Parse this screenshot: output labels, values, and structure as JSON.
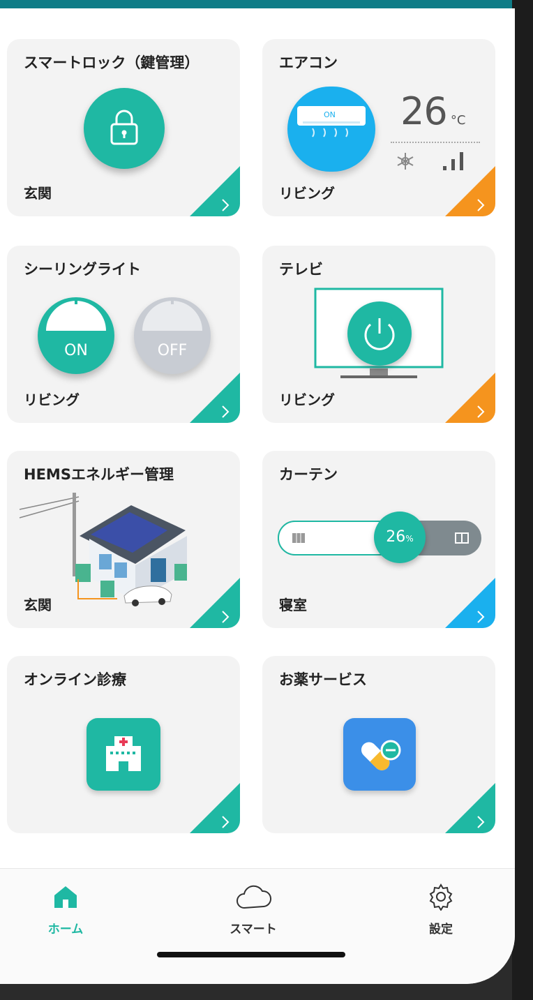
{
  "cards": {
    "lock": {
      "title": "スマートロック（鍵管理）",
      "room": "玄関",
      "icon": "padlock-icon"
    },
    "aircon": {
      "title": "エアコン",
      "room": "リビング",
      "temp": "26",
      "unit": "°C",
      "unit_label": "ON",
      "mode_icon": "snowflake-icon",
      "fan_icon": "signal-bars-icon"
    },
    "ceiling": {
      "title": "シーリングライト",
      "room": "リビング",
      "on_label": "ON",
      "off_label": "OFF"
    },
    "tv": {
      "title": "テレビ",
      "room": "リビング",
      "icon": "power-icon"
    },
    "hems": {
      "title": "HEMSエネルギー管理",
      "room": "玄関"
    },
    "curtain": {
      "title": "カーテン",
      "room": "寝室",
      "level": "26",
      "level_unit": "%"
    },
    "clinic": {
      "title": "オンライン診療",
      "icon": "hospital-icon"
    },
    "medicine": {
      "title": "お薬サービス",
      "icon": "pill-icon"
    }
  },
  "nav": {
    "home": "ホーム",
    "smart": "スマート",
    "settings": "設定"
  },
  "colors": {
    "accent": "#1fb8a3",
    "orange": "#f5941e",
    "blue": "#1ab0ee",
    "card_bg": "#f3f3f3"
  }
}
